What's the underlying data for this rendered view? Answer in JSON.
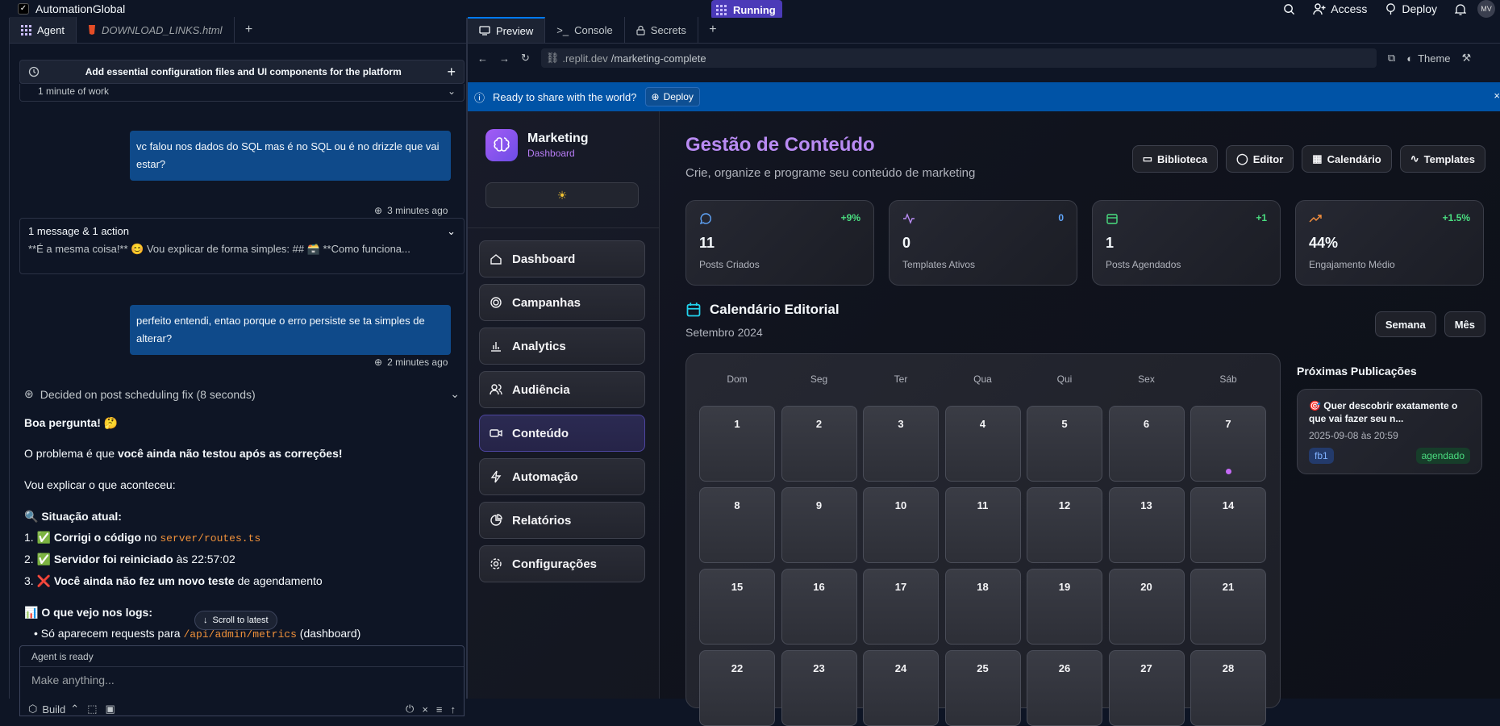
{
  "topbar": {
    "app_name": "AutomationGlobal",
    "status": "Running",
    "access": "Access",
    "deploy": "Deploy",
    "avatar": "MV"
  },
  "agent_panel": {
    "tabs": [
      {
        "label": "Agent"
      },
      {
        "label": "DOWNLOAD_LINKS.html"
      }
    ],
    "task_title": "Add essential configuration files and UI components for the platform",
    "work_time": "1 minute of work",
    "messages": [
      {
        "text": "vc falou nos dados do SQL mas é no SQL ou é no drizzle que vai estar?",
        "time": "3 minutes ago"
      },
      {
        "text": "perfeito entendi, entao porque o erro persiste se ta simples de alterar?",
        "time": "2 minutes ago"
      }
    ],
    "summary_title": "1 message & 1 action",
    "summary_preview": "**É a mesma coisa!** 😊 Vou explicar de forma simples: ## 🗃️ **Como funciona...",
    "decided": "Decided on post scheduling fix (8 seconds)",
    "response": {
      "p1": "Boa pergunta! 🤔",
      "p2_a": "O problema é que ",
      "p2_b": "você ainda não testou após as correções!",
      "p3": "Vou explicar o que aconteceu:",
      "h1": "🔍 Situação atual:",
      "l1_a": "1. ✅ ",
      "l1_b": "Corrigi o código",
      "l1_c": " no ",
      "l1_code": "server/routes.ts",
      "l2_a": "2. ✅ ",
      "l2_b": "Servidor foi reiniciado",
      "l2_c": " às 22:57:02",
      "l3_a": "3. ❌ ",
      "l3_b": "Você ainda não fez um novo teste",
      "l3_c": " de agendamento",
      "h2": "📊 O que vejo nos logs:",
      "b1_a": "•  Só aparecem requests para ",
      "b1_code": "/api/admin/metrics",
      "b1_c": " (dashboard)"
    },
    "scroll_latest": "Scroll to latest",
    "composer_status": "Agent is ready",
    "composer_placeholder": "Make anything...",
    "build_label": "Build"
  },
  "preview": {
    "tabs": [
      {
        "label": "Preview"
      },
      {
        "label": "Console"
      },
      {
        "label": "Secrets"
      }
    ],
    "url_host": ".replit.dev",
    "url_path": "/marketing-complete",
    "theme_label": "Theme",
    "banner_text": "Ready to share with the world?",
    "banner_deploy": "Deploy"
  },
  "app": {
    "brand_title": "Marketing",
    "brand_subtitle": "Dashboard",
    "nav": [
      {
        "label": "Dashboard",
        "icon": "home-icon"
      },
      {
        "label": "Campanhas",
        "icon": "target-icon"
      },
      {
        "label": "Analytics",
        "icon": "bar-chart-icon"
      },
      {
        "label": "Audiência",
        "icon": "users-icon"
      },
      {
        "label": "Conteúdo",
        "icon": "video-icon"
      },
      {
        "label": "Automação",
        "icon": "zap-icon"
      },
      {
        "label": "Relatórios",
        "icon": "pie-chart-icon"
      },
      {
        "label": "Configurações",
        "icon": "gear-icon"
      }
    ],
    "page_title": "Gestão de Conteúdo",
    "page_subtitle": "Crie, organize e programe seu conteúdo de marketing",
    "header_buttons": [
      "Biblioteca",
      "Editor",
      "Calendário",
      "Templates"
    ],
    "stats": [
      {
        "value": "11",
        "label": "Posts Criados",
        "delta": "+9%",
        "color": "#4ade80"
      },
      {
        "value": "0",
        "label": "Templates Ativos",
        "delta": "0",
        "color": "#60a5fa"
      },
      {
        "value": "1",
        "label": "Posts Agendados",
        "delta": "+1",
        "color": "#4ade80"
      },
      {
        "value": "44%",
        "label": "Engajamento Médio",
        "delta": "+1.5%",
        "color": "#4ade80"
      }
    ],
    "calendar_title": "Calendário Editorial",
    "calendar_month": "Setembro 2024",
    "view_buttons": [
      "Semana",
      "Mês"
    ],
    "weekdays": [
      "Dom",
      "Seg",
      "Ter",
      "Qua",
      "Qui",
      "Sex",
      "Sáb"
    ],
    "days": [
      "1",
      "2",
      "3",
      "4",
      "5",
      "6",
      "7",
      "8",
      "9",
      "10",
      "11",
      "12",
      "13",
      "14",
      "15",
      "16",
      "17",
      "18",
      "19",
      "20",
      "21",
      "22",
      "23",
      "24",
      "25",
      "26",
      "27",
      "28"
    ],
    "upcoming_title": "Próximas Publicações",
    "upcoming_post": {
      "title": "🎯 Quer descobrir exatamente o que vai fazer seu n...",
      "date": "2025-09-08 às 20:59",
      "tag": "fb1",
      "status": "agendado"
    }
  }
}
